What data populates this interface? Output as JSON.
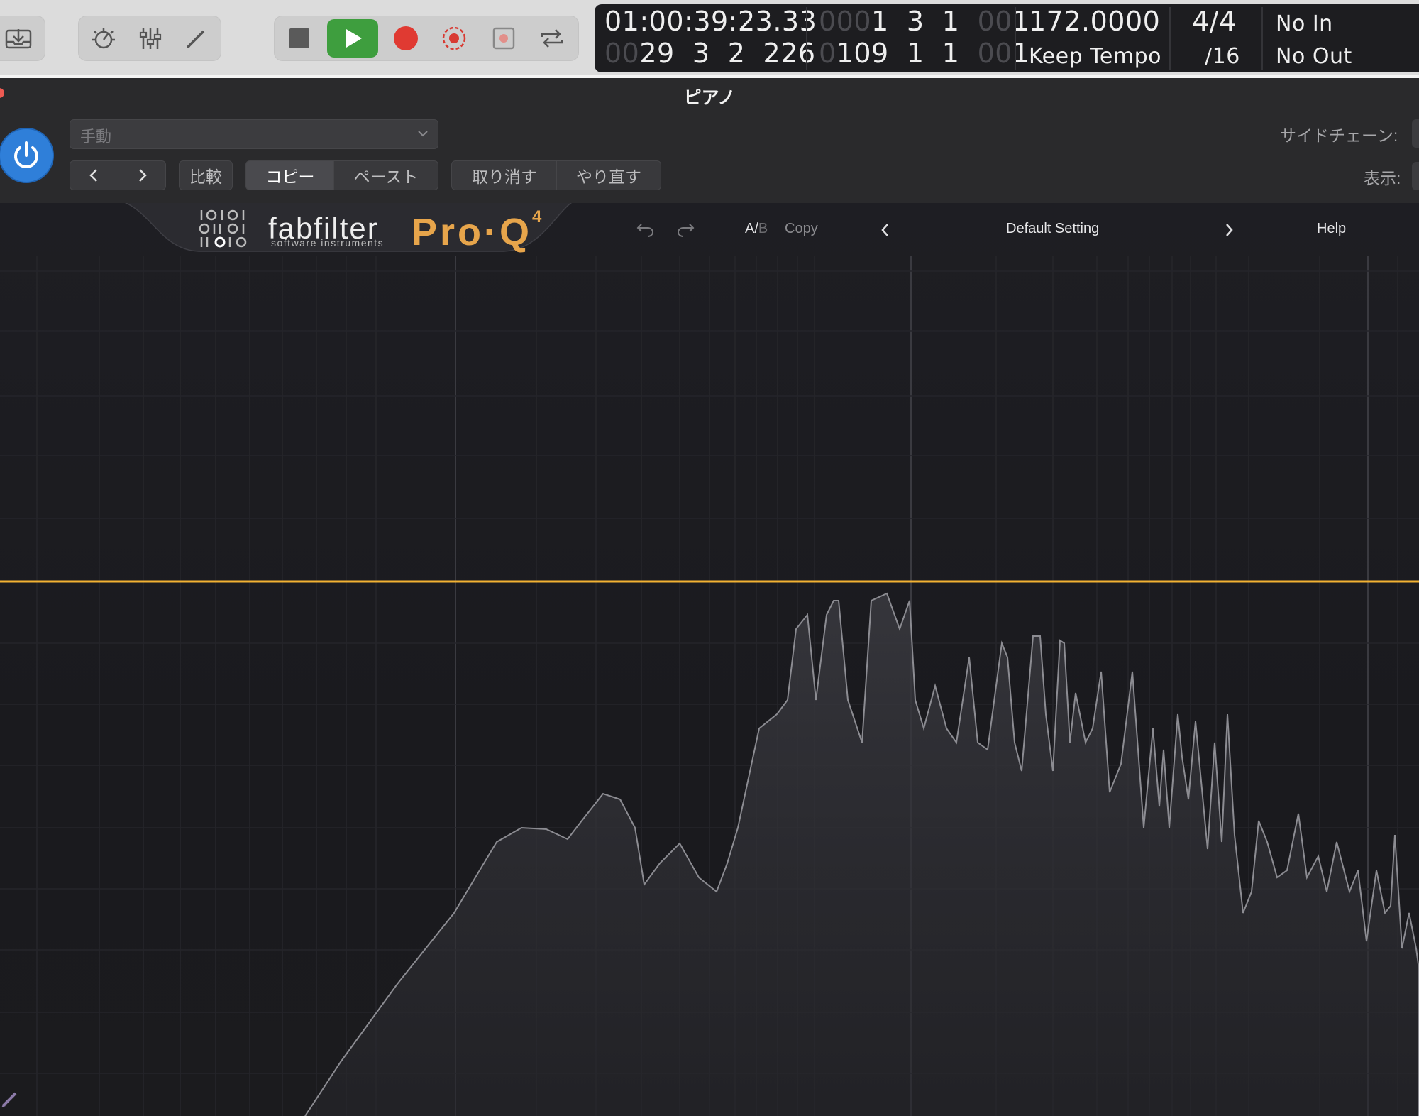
{
  "toolbar": {
    "lcd": {
      "timecode": "01:00:39:23.33",
      "position_row1": {
        "dim_prefix": "000",
        "value": "1  3  1",
        "dim_tick": "00",
        "tick": "1"
      },
      "position_row2": {
        "dim_prefix": "00",
        "value": "29  3  2  226"
      },
      "end_row1": {
        "dim_prefix": "0",
        "value": "109  1  1",
        "dim_tick": "00",
        "tick": "1"
      },
      "tempo": "172.0000",
      "tempo_mode": "Keep Tempo",
      "signature": "4/4",
      "division": "/16",
      "midi_in": "No In",
      "midi_out": "No Out"
    },
    "icons": [
      "inbox-icon",
      "metronome-icon",
      "mixer-icon",
      "pencil-icon",
      "stop-icon",
      "play-icon",
      "record-icon",
      "replace-record-icon",
      "autopunch-icon",
      "cycle-icon"
    ]
  },
  "plugin": {
    "title": "ピアノ",
    "preset_value": "手動",
    "compare_label": "比較",
    "copy_label": "コピー",
    "paste_label": "ペースト",
    "undo_label": "取り消す",
    "redo_label": "やり直す",
    "sidechain_label": "サイドチェーン:",
    "view_label": "表示:"
  },
  "fabfilter": {
    "brand": "fabfilter",
    "brand_sub": "software instruments",
    "product": "Pro·Q",
    "product_version": "4",
    "ab_a": "A/",
    "ab_b": "B",
    "copy_label": "Copy",
    "preset_name": "Default Setting",
    "help_label": "Help",
    "accent_color": "#e7a54b",
    "eq_curve_color": "#f2b233"
  }
}
